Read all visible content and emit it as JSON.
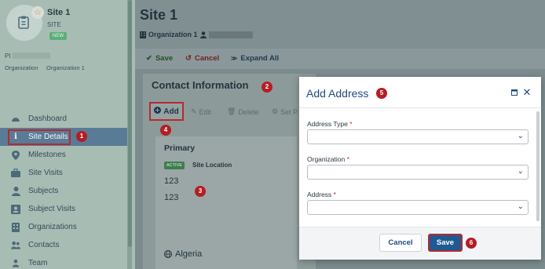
{
  "site": {
    "name": "Site 1",
    "type": "SITE",
    "status_badge": "NEW",
    "pi_label": "PI",
    "org_label": "Organization",
    "org_value": "Organization 1"
  },
  "nav": {
    "items": [
      {
        "label": "Dashboard",
        "icon": "dashboard-icon"
      },
      {
        "label": "Site Details",
        "icon": "info-icon"
      },
      {
        "label": "Milestones",
        "icon": "map-pin-icon"
      },
      {
        "label": "Site Visits",
        "icon": "briefcase-icon"
      },
      {
        "label": "Subjects",
        "icon": "person-icon"
      },
      {
        "label": "Subject Visits",
        "icon": "person-card-icon"
      },
      {
        "label": "Organizations",
        "icon": "building-icon"
      },
      {
        "label": "Contacts",
        "icon": "people-icon"
      },
      {
        "label": "Team",
        "icon": "team-icon"
      }
    ],
    "active_index": 1
  },
  "header": {
    "title": "Site 1",
    "org": "Organization 1"
  },
  "toolbar": {
    "save_label": "Save",
    "cancel_label": "Cancel",
    "expand_label": "Expand All"
  },
  "contact": {
    "section_title": "Contact Information",
    "add_label": "Add",
    "edit_label": "Edit",
    "delete_label": "Delete",
    "set_label": "Set P",
    "entry": {
      "title": "Primary",
      "status": "ACTIVE",
      "type": "Site Location",
      "line1": "123",
      "line2": "123",
      "country": "Algeria"
    }
  },
  "modal": {
    "title": "Add Address",
    "fields": [
      {
        "label": "Address Type",
        "required": "*",
        "value": ""
      },
      {
        "label": "Organization",
        "required": "*",
        "value": ""
      },
      {
        "label": "Address",
        "required": "*",
        "value": ""
      }
    ],
    "cancel_label": "Cancel",
    "save_label": "Save"
  },
  "steps": [
    "1",
    "2",
    "3",
    "4",
    "5",
    "6"
  ],
  "colors": {
    "accent": "#1f5a92",
    "highlight": "#b32b30",
    "step_badge": "#b51d24",
    "active_tag": "#3e7e4d"
  }
}
